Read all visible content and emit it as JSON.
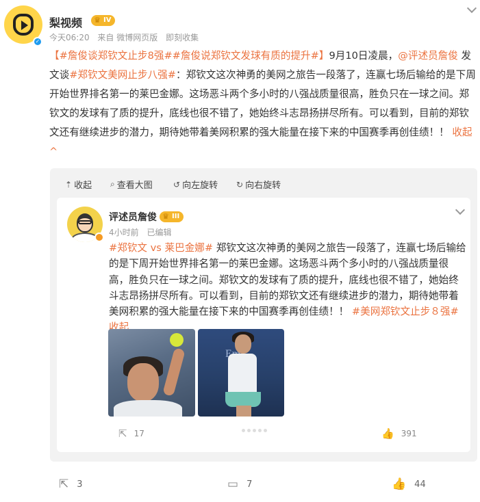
{
  "post": {
    "author": "梨视频",
    "level": "IV",
    "meta": {
      "time": "今天06:20",
      "source": "来自 微博网页版",
      "action": "即刻收集"
    },
    "text": {
      "tag1": "【#詹俊谈郑钦文止步8强##詹俊说郑钦文发球有质的提升#】",
      "t1": "9月10日凌晨，",
      "mention": "@评述员詹俊",
      "t2": " 发文谈",
      "tag2": "#郑钦文美网止步八强#",
      "t3": "：郑钦文这次神勇的美网之旅告一段落了，连赢七场后输给的是下周开始世界排名第一的莱巴金娜。这场恶斗两个多小时的八强战质量很高，胜负只在一球之间。郑钦文的发球有了质的提升，底线也很不错了，她始终斗志昂扬拼尽所有。可以看到，目前的郑钦文还有继续进步的潜力，期待她带着美网积累的强大能量在接下来的中国赛季再创佳绩！！ ",
      "collapse": "收起"
    }
  },
  "toolbar": {
    "collapse": "收起",
    "view_large": "查看大图",
    "rotate_left": "向左旋转",
    "rotate_right": "向右旋转"
  },
  "retweet": {
    "author": "评述员詹俊",
    "level": "III",
    "meta": {
      "time": "4小时前",
      "edited": "已编辑"
    },
    "text": {
      "tag1": "#郑钦文 vs 莱巴金娜#",
      "t1": " 郑钦文这次神勇的美网之旅告一段落了，连赢七场后输给的是下周开始世界排名第一的莱巴金娜。这场恶斗两个多小时的八强战质量很高，胜负只在一球之间。郑钦文的发球有了质的提升，底线也很不错了，她始终斗志昂扬拼尽所有。可以看到，目前的郑钦文还有继续进步的潜力，期待她带着美网积累的强大能量在接下来的中国赛季再创佳绩！！",
      "tag2": "#美网郑钦文止步８强#",
      "collapse": "收起"
    },
    "photo2_sign": "Em",
    "reposts": "17",
    "likes": "391"
  },
  "bottom": {
    "reposts": "3",
    "comments": "7",
    "likes": "44"
  },
  "icons": [
    "avatar-play-logo",
    "verified-icon",
    "crown-icon",
    "chevron-down-icon",
    "collapse-icon",
    "search-icon",
    "rotate-left-icon",
    "rotate-right-icon",
    "repost-icon",
    "comment-icon",
    "like-icon"
  ],
  "colors": {
    "link": "#eb7340",
    "badge": "#f5b62b",
    "verify": "#1e9bf0",
    "panel": "#f2f2f2"
  }
}
